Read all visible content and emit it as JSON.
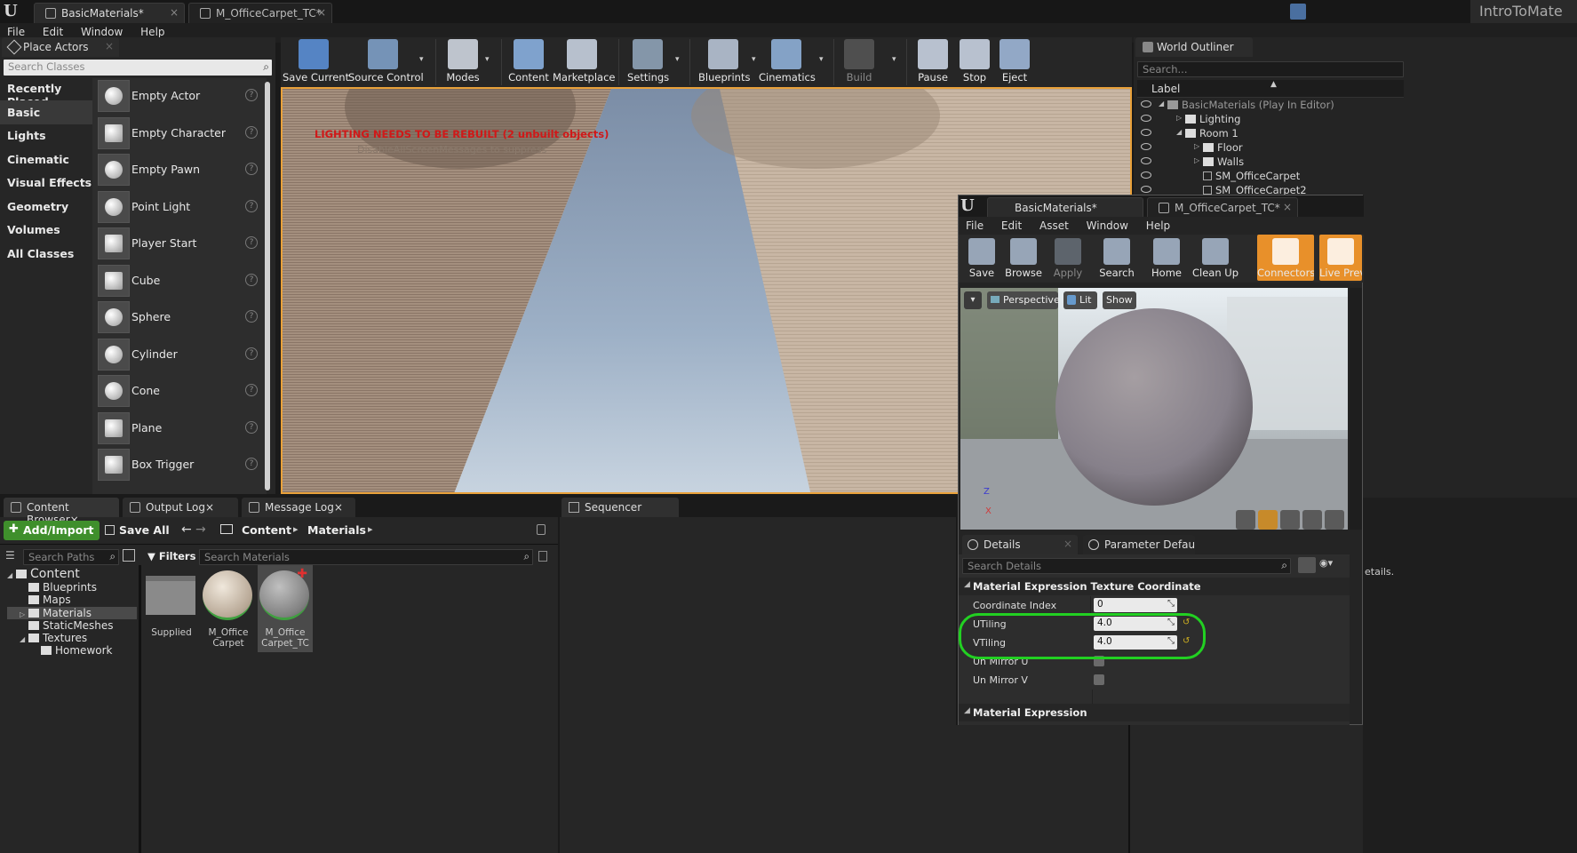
{
  "tabs": [
    {
      "label": "BasicMaterials*"
    },
    {
      "label": "M_OfficeCarpet_TC*"
    }
  ],
  "project_name": "IntroToMate",
  "menu": [
    "File",
    "Edit",
    "Window",
    "Help"
  ],
  "place_actors": {
    "tab_label": "Place Actors",
    "search_placeholder": "Search Classes",
    "categories": [
      "Recently Placed",
      "Basic",
      "Lights",
      "Cinematic",
      "Visual Effects",
      "Geometry",
      "Volumes",
      "All Classes"
    ],
    "selected_category": "Basic",
    "actors": [
      "Empty Actor",
      "Empty Character",
      "Empty Pawn",
      "Point Light",
      "Player Start",
      "Cube",
      "Sphere",
      "Cylinder",
      "Cone",
      "Plane",
      "Box Trigger"
    ]
  },
  "toolbar": {
    "buttons": [
      {
        "label": "Save Current",
        "icon": "save-icon"
      },
      {
        "label": "Source Control",
        "icon": "source-control-icon"
      },
      {
        "label": "Modes",
        "icon": "modes-icon"
      },
      {
        "label": "Content",
        "icon": "content-icon"
      },
      {
        "label": "Marketplace",
        "icon": "marketplace-icon"
      },
      {
        "label": "Settings",
        "icon": "settings-icon"
      },
      {
        "label": "Blueprints",
        "icon": "blueprints-icon"
      },
      {
        "label": "Cinematics",
        "icon": "cinematics-icon"
      },
      {
        "label": "Build",
        "icon": "build-icon"
      },
      {
        "label": "Pause",
        "icon": "pause-icon"
      },
      {
        "label": "Stop",
        "icon": "stop-icon"
      },
      {
        "label": "Eject",
        "icon": "eject-icon"
      }
    ]
  },
  "viewport": {
    "warning": "LIGHTING NEEDS TO BE REBUILT (2 unbuilt objects)",
    "hint": "DisableAllScreenMessages to suppress"
  },
  "outliner": {
    "tab_label": "World Outliner",
    "search_placeholder": "Search...",
    "column": "Label",
    "rows": [
      "BasicMaterials (Play In Editor)",
      "Lighting",
      "Room 1",
      "Floor",
      "Walls",
      "SM_OfficeCarpet",
      "SM_OfficeCarpet2"
    ]
  },
  "material_editor": {
    "tabs": [
      "BasicMaterials*",
      "M_OfficeCarpet_TC*"
    ],
    "menu": [
      "File",
      "Edit",
      "Asset",
      "Window",
      "Help"
    ],
    "buttons": [
      {
        "label": "Save",
        "icon": "save-icon"
      },
      {
        "label": "Browse",
        "icon": "browse-icon"
      },
      {
        "label": "Apply",
        "icon": "apply-icon"
      },
      {
        "label": "Search",
        "icon": "search-icon"
      },
      {
        "label": "Home",
        "icon": "home-icon"
      },
      {
        "label": "Clean Up",
        "icon": "clean-up-icon"
      },
      {
        "label": "Connectors",
        "icon": "connectors-icon"
      },
      {
        "label": "Live Prev",
        "icon": "live-preview-icon"
      }
    ],
    "viewport_buttons": {
      "perspective": "Perspective",
      "lit": "Lit",
      "show": "Show"
    },
    "axis": {
      "z": "Z",
      "x": "X"
    },
    "details_tab": "Details",
    "params_tab": "Parameter Defaults",
    "search_placeholder": "Search Details",
    "section": "Material Expression Texture Coordinate",
    "section2": "Material Expression",
    "fields": {
      "coordinate_index": {
        "label": "Coordinate Index",
        "value": "0"
      },
      "utiling": {
        "label": "UTiling",
        "value": "4.0"
      },
      "vtiling": {
        "label": "VTiling",
        "value": "4.0"
      },
      "unmirror_u": {
        "label": "Un Mirror U"
      },
      "unmirror_v": {
        "label": "Un Mirror V"
      }
    },
    "right_edge_text": "etails."
  },
  "content_browser": {
    "tabs": [
      "Content Browser",
      "Output Log",
      "Message Log"
    ],
    "add_import": "Add/Import",
    "save_all": "Save All",
    "breadcrumb": [
      "Content",
      "Materials"
    ],
    "search_paths": "Search Paths",
    "filters": "Filters",
    "search_materials": "Search Materials",
    "tree": [
      "Content",
      "Blueprints",
      "Maps",
      "Materials",
      "StaticMeshes",
      "Textures",
      "Homework"
    ],
    "assets": [
      {
        "name": "Supplied"
      },
      {
        "name": "M_Office Carpet"
      },
      {
        "name": "M_Office Carpet_TC"
      }
    ]
  },
  "sequencer": {
    "tab_label": "Sequencer"
  }
}
